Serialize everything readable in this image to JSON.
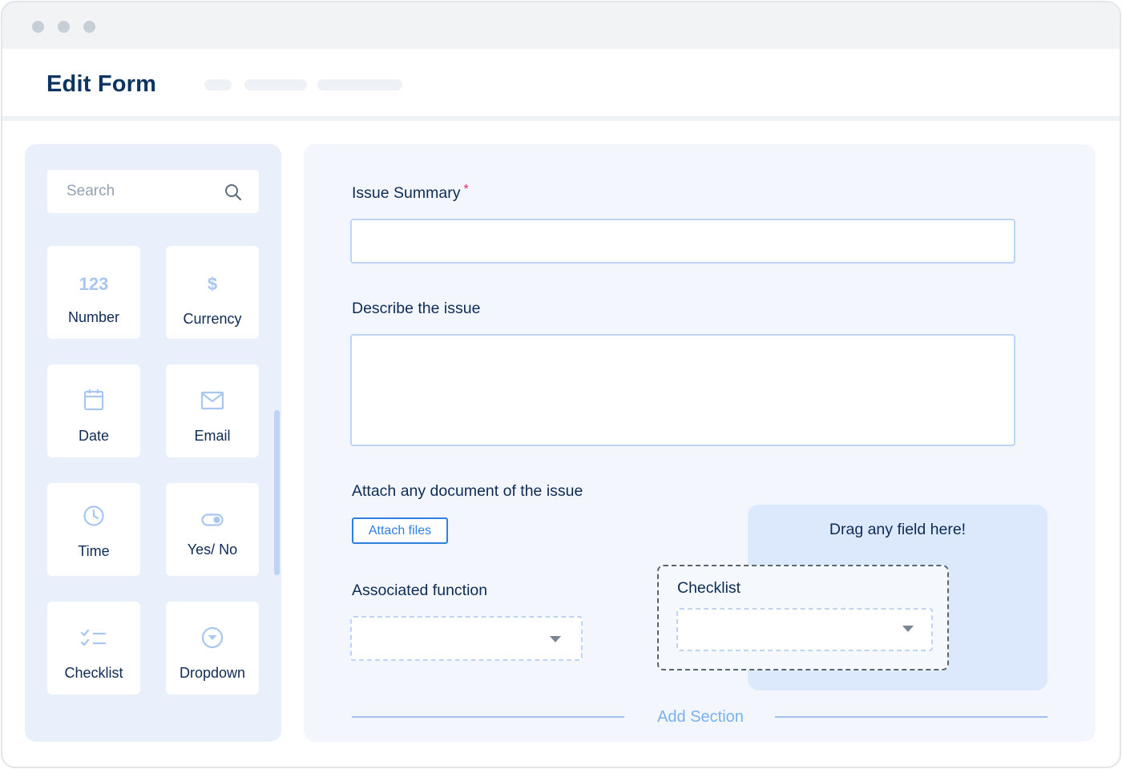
{
  "window": {
    "traffic_lights": [
      "window-dot",
      "window-dot",
      "window-dot"
    ]
  },
  "header": {
    "title": "Edit Form"
  },
  "sidebar": {
    "search": {
      "placeholder": "Search",
      "icon": "search-icon"
    },
    "fields": [
      {
        "label": "Number",
        "icon": "number-icon",
        "glyph": "123"
      },
      {
        "label": "Currency",
        "icon": "currency-icon",
        "glyph": "$"
      },
      {
        "label": "Date",
        "icon": "calendar-icon"
      },
      {
        "label": "Email",
        "icon": "envelope-icon"
      },
      {
        "label": "Time",
        "icon": "clock-icon"
      },
      {
        "label": "Yes/ No",
        "icon": "toggle-icon"
      },
      {
        "label": "Checklist",
        "icon": "checklist-icon"
      },
      {
        "label": "Dropdown",
        "icon": "dropdown-circle-icon"
      }
    ]
  },
  "form": {
    "issue_summary": {
      "label": "Issue Summary",
      "required_mark": "*",
      "value": ""
    },
    "describe": {
      "label": "Describe the issue",
      "value": ""
    },
    "attach": {
      "label": "Attach any document of the issue",
      "button": "Attach files"
    },
    "associated_function": {
      "label": "Associated function",
      "value": ""
    },
    "dropzone": {
      "text": "Drag any field here!"
    },
    "dragging_field": {
      "label": "Checklist",
      "value": ""
    },
    "add_section": "Add Section"
  },
  "colors": {
    "title": "#0d3561",
    "accent": "#2d7fe0",
    "required": "#e0227a",
    "sidebar_bg": "#e9f0fb",
    "main_bg": "#f3f7fd",
    "icon": "#a8c7f0"
  }
}
